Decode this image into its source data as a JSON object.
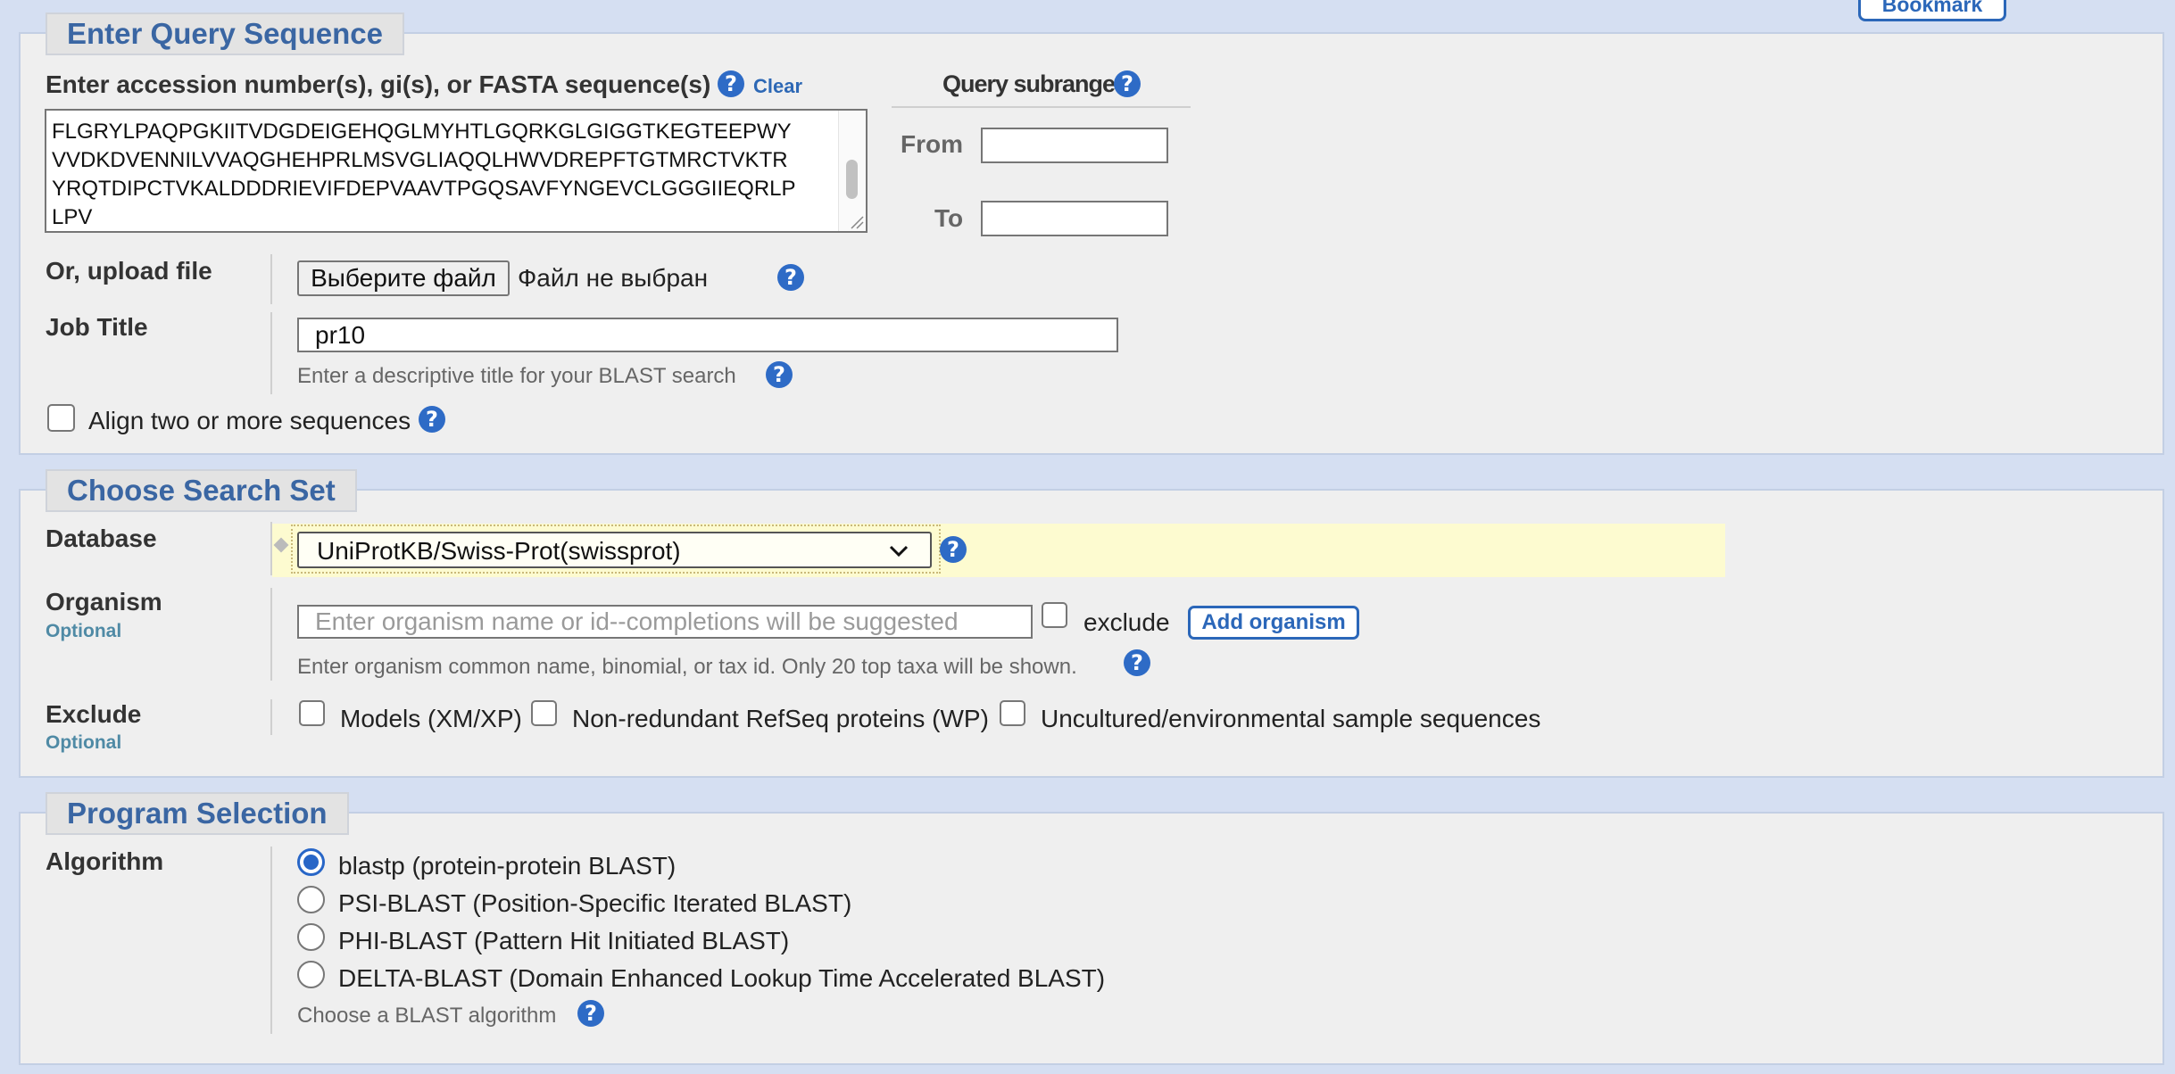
{
  "header": {
    "bookmark_label": "Bookmark"
  },
  "query_section": {
    "legend": "Enter Query Sequence",
    "sequence_label": "Enter accession number(s), gi(s), or FASTA sequence(s)",
    "clear_label": "Clear",
    "sequence_lines": [
      "FLGRYLPAQPGKIITVDGDEIGEHQGLMYHTLGQRKGLGIGGTKEGTEEPWY",
      "VVDKDVENNILVVAQGHEHPRLMSVGLIAQQLHWVDREPFTGTMRCTVKTR",
      "YRQTDIPCTVKALDDDRIEVIFDEPVAAVTPGQSAVFYNGEVCLGGGIIEQRLP",
      "LPV"
    ],
    "subrange_title": "Query subrange",
    "from_label": "From",
    "from_value": "",
    "to_label": "To",
    "to_value": "",
    "upload_label": "Or, upload file",
    "file_button_label": "Выберите файл",
    "file_status": "Файл не выбран",
    "job_title_label": "Job Title",
    "job_title_value": "pr10",
    "job_title_hint": "Enter a descriptive title for your BLAST search",
    "align_label": "Align two or more sequences",
    "align_checked": false
  },
  "search_set": {
    "legend": "Choose Search Set",
    "database_label": "Database",
    "database_selected": "UniProtKB/Swiss-Prot(swissprot)",
    "organism_label": "Organism",
    "organism_optional": "Optional",
    "organism_placeholder": "Enter organism name or id--completions will be suggested",
    "exclude_checkbox_label": "exclude",
    "add_organism_label": "Add organism",
    "organism_hint": "Enter organism common name, binomial, or tax id. Only 20 top taxa will be shown.",
    "exclude_label": "Exclude",
    "exclude_optional": "Optional",
    "exclude_options": [
      "Models (XM/XP)",
      "Non-redundant RefSeq proteins (WP)",
      "Uncultured/environmental sample sequences"
    ]
  },
  "program": {
    "legend": "Program Selection",
    "algorithm_label": "Algorithm",
    "options": [
      "blastp (protein-protein BLAST)",
      "PSI-BLAST (Position-Specific Iterated BLAST)",
      "PHI-BLAST (Pattern Hit Initiated BLAST)",
      "DELTA-BLAST (Domain Enhanced Lookup Time Accelerated BLAST)"
    ],
    "selected_option": "blastp (protein-protein BLAST)",
    "hint": "Choose a BLAST algorithm"
  },
  "colors": {
    "page_background": "#d5dff2",
    "panel_background": "#efefef",
    "legend_text": "#3a66a3",
    "help_icon": "#2e6bc6",
    "database_highlight": "#fdfbd0"
  }
}
